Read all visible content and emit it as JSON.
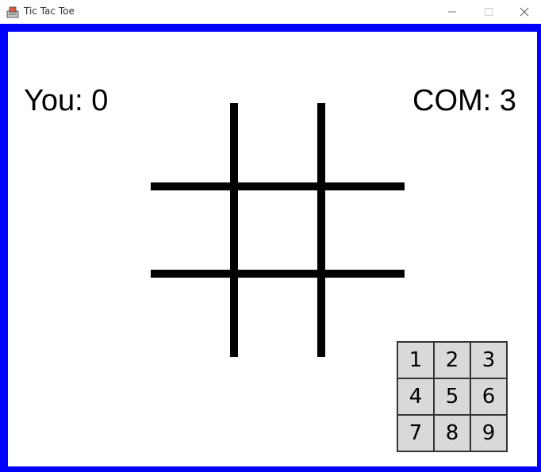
{
  "window": {
    "title": "Tic Tac Toe",
    "icon": "java-app-icon",
    "border_color": "#0000ff"
  },
  "score": {
    "you_label": "You: 0",
    "com_label": "COM: 3"
  },
  "board": {
    "cells": [
      "",
      "",
      "",
      "",
      "",
      "",
      "",
      "",
      ""
    ]
  },
  "keypad": {
    "keys": [
      "1",
      "2",
      "3",
      "4",
      "5",
      "6",
      "7",
      "8",
      "9"
    ],
    "key_color": "#d9d9d9"
  }
}
